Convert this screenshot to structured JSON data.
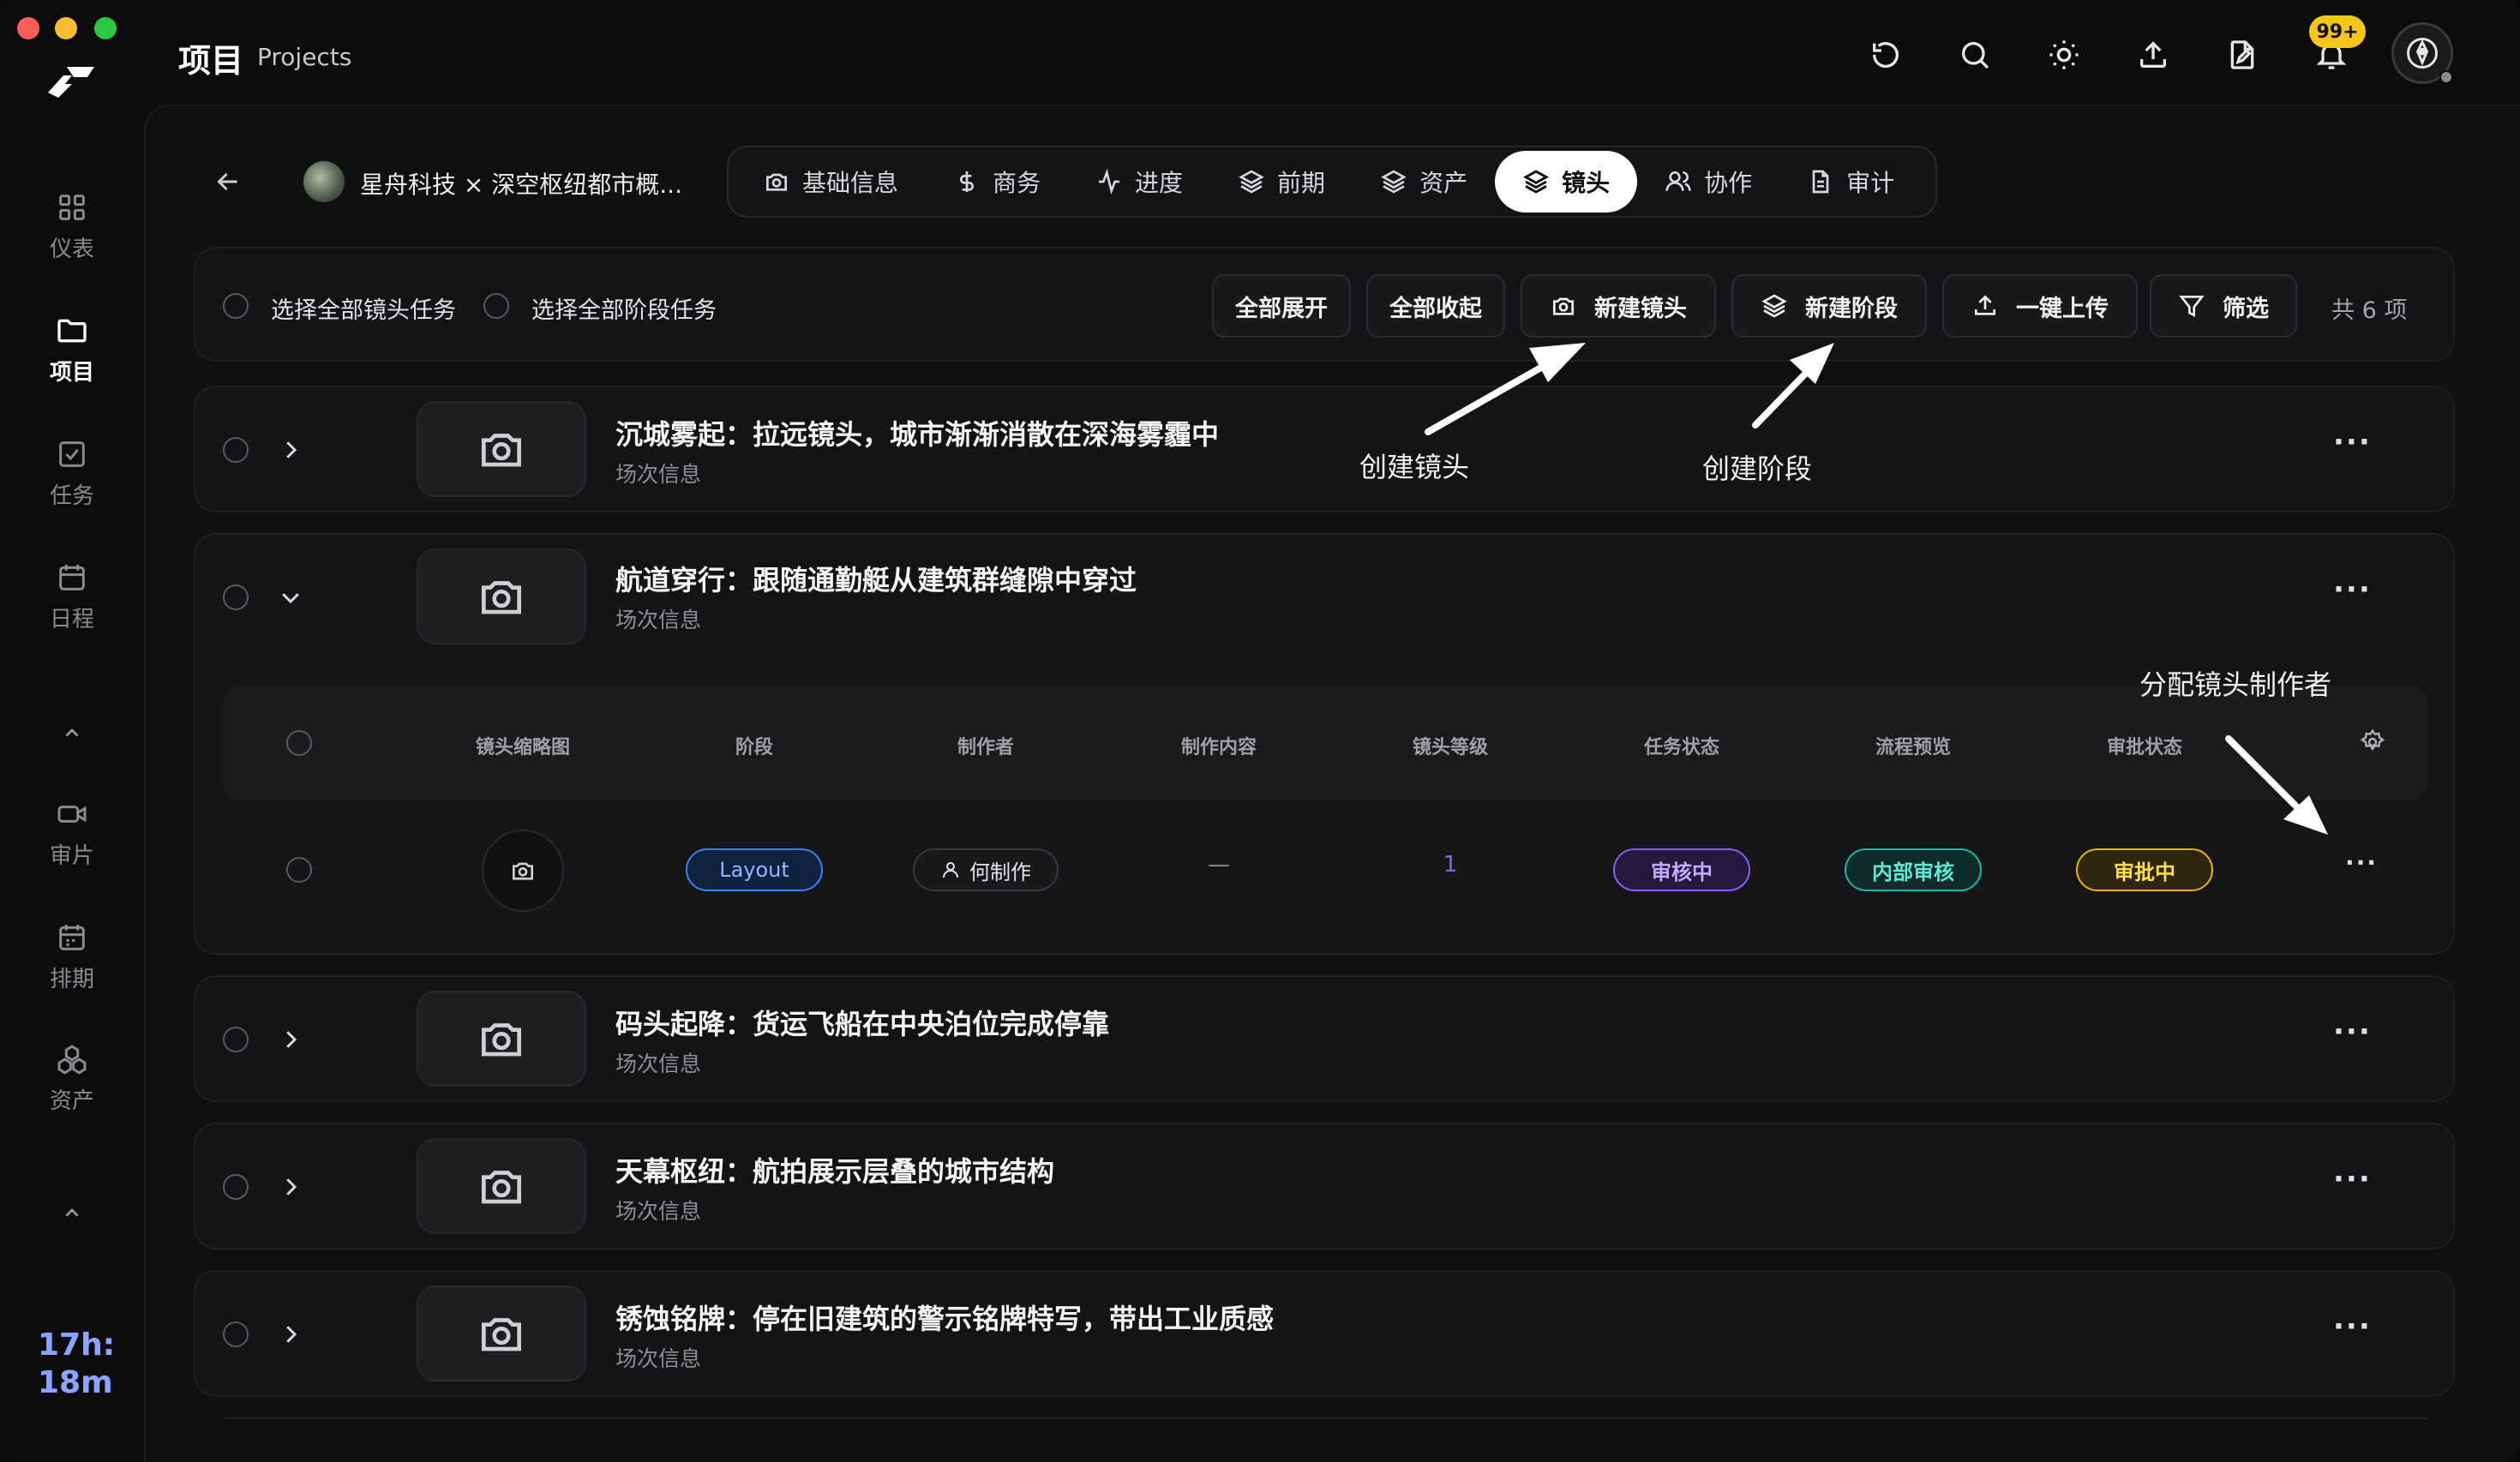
{
  "window": {
    "controls": [
      "close",
      "minimize",
      "maximize"
    ],
    "colors": {
      "close": "#ff5f57",
      "minimize": "#febc2e",
      "maximize": "#28c840"
    }
  },
  "header": {
    "title_cn": "项目",
    "title_en": "Projects",
    "icons": [
      "refresh-icon",
      "search-icon",
      "sun-icon",
      "upload-icon",
      "file-icon",
      "bell-icon",
      "avatar"
    ],
    "notification_badge": "99+"
  },
  "sidebar": {
    "items": [
      {
        "label": "仪表",
        "icon": "grid-icon",
        "active": false
      },
      {
        "label": "项目",
        "icon": "folder-icon",
        "active": true
      },
      {
        "label": "任务",
        "icon": "checkbox-icon",
        "active": false
      },
      {
        "label": "日程",
        "icon": "calendar-icon",
        "active": false
      },
      {
        "label": "审片",
        "icon": "video-icon",
        "active": false
      },
      {
        "label": "排期",
        "icon": "schedule-icon",
        "active": false
      },
      {
        "label": "资产",
        "icon": "asset-icon",
        "active": false
      }
    ],
    "timer": {
      "line1": "17h:",
      "line2": "18m"
    }
  },
  "project": {
    "name": "星舟科技 × 深空枢纽都市概..."
  },
  "tabs": [
    {
      "label": "基础信息",
      "icon": "camera-icon"
    },
    {
      "label": "商务",
      "icon": "dollar-icon"
    },
    {
      "label": "进度",
      "icon": "activity-icon"
    },
    {
      "label": "前期",
      "icon": "layers-icon"
    },
    {
      "label": "资产",
      "icon": "layers-icon"
    },
    {
      "label": "镜头",
      "icon": "layers-icon",
      "active": true
    },
    {
      "label": "协作",
      "icon": "users-icon"
    },
    {
      "label": "审计",
      "icon": "document-icon"
    }
  ],
  "toolbar": {
    "select_all_shots": "选择全部镜头任务",
    "select_all_stages": "选择全部阶段任务",
    "expand_all": "全部展开",
    "collapse_all": "全部收起",
    "new_shot": "新建镜头",
    "new_stage": "新建阶段",
    "upload": "一键上传",
    "filter": "筛选",
    "count": "共 6 项"
  },
  "shots": [
    {
      "title": "沉城雾起：拉远镜头，城市渐渐消散在深海雾霾中",
      "subtitle": "场次信息",
      "expanded": false
    },
    {
      "title": "航道穿行：跟随通勤艇从建筑群缝隙中穿过",
      "subtitle": "场次信息",
      "expanded": true
    },
    {
      "title": "码头起降：货运飞船在中央泊位完成停靠",
      "subtitle": "场次信息",
      "expanded": false
    },
    {
      "title": "天幕枢纽：航拍展示层叠的城市结构",
      "subtitle": "场次信息",
      "expanded": false
    },
    {
      "title": "锈蚀铭牌：停在旧建筑的警示铭牌特写，带出工业质感",
      "subtitle": "场次信息",
      "expanded": false
    }
  ],
  "subtable": {
    "columns": [
      "镜头缩略图",
      "阶段",
      "制作者",
      "制作内容",
      "镜头等级",
      "任务状态",
      "流程预览",
      "审批状态"
    ],
    "row": {
      "stage": "Layout",
      "maker": "何制作",
      "content": "—",
      "level": "1",
      "task_status": "审核中",
      "flow": "内部审核",
      "approval": "审批中"
    },
    "status_colors": {
      "stage": "#3b82f6",
      "task_status": "#8b5cf6",
      "flow": "#14b8a6",
      "approval": "#eab308",
      "level": "#7c6cf0"
    }
  },
  "annotations": {
    "create_shot": "创建镜头",
    "create_stage": "创建阶段",
    "assign_maker": "分配镜头制作者"
  }
}
